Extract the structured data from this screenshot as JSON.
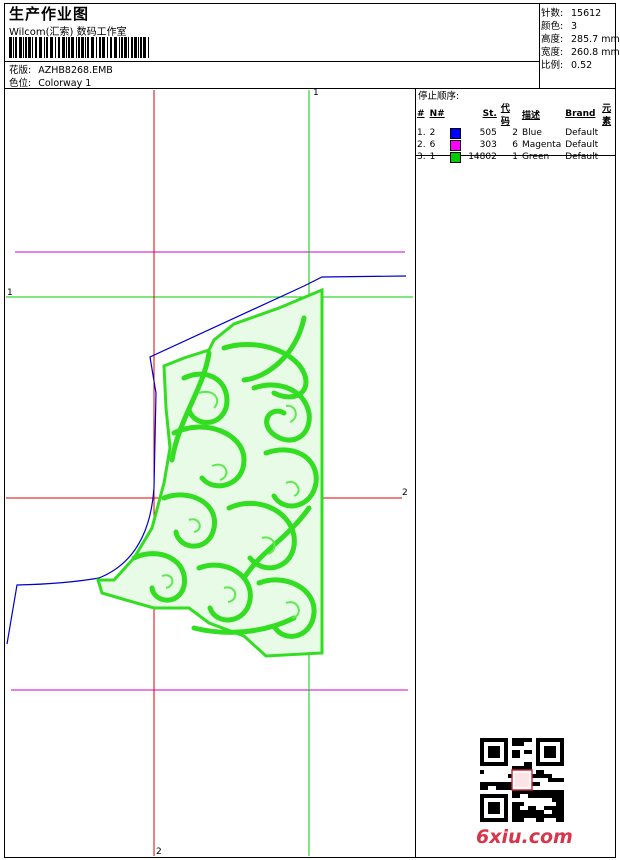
{
  "header": {
    "title": "生产作业图",
    "software": "Wilcom(汇索) 数码工作室",
    "design_label": "花版:",
    "design_file": "AZHB8268.EMB",
    "colorway_label": "色位:",
    "colorway": "Colorway 1"
  },
  "stats": [
    {
      "label": "针数:",
      "value": "15612"
    },
    {
      "label": "颜色:",
      "value": "3"
    },
    {
      "label": "高度:",
      "value": "285.7 mm"
    },
    {
      "label": "宽度:",
      "value": "260.8 mm"
    },
    {
      "label": "比例:",
      "value": "0.52"
    }
  ],
  "sequence": {
    "title": "停止顺序:",
    "headers": [
      "#",
      "N#",
      "",
      "St.",
      "代码",
      "描述",
      "Brand",
      "元素"
    ],
    "rows": [
      {
        "no": "1.",
        "n": "2",
        "color": "#0000ff",
        "st": "505",
        "code": "2",
        "desc": "Blue",
        "brand": "Default",
        "element": ""
      },
      {
        "no": "2.",
        "n": "6",
        "color": "#ff00ff",
        "st": "303",
        "code": "6",
        "desc": "Magenta",
        "brand": "Default",
        "element": ""
      },
      {
        "no": "3.",
        "n": "1",
        "color": "#00cc00",
        "st": "14802",
        "code": "1",
        "desc": "Green",
        "brand": "Default",
        "element": ""
      }
    ]
  },
  "guides": {
    "label_1_top": "1",
    "label_1_left": "1",
    "label_2_right": "2",
    "label_2_bottom": "2"
  },
  "watermark": "6xiu.com",
  "colors": {
    "red_guide": "#e00000",
    "green_guide": "#00cc00",
    "magenta_guide": "#cc00cc",
    "outline_blue": "#0000cc",
    "embroidery_green": "#33dd22"
  }
}
